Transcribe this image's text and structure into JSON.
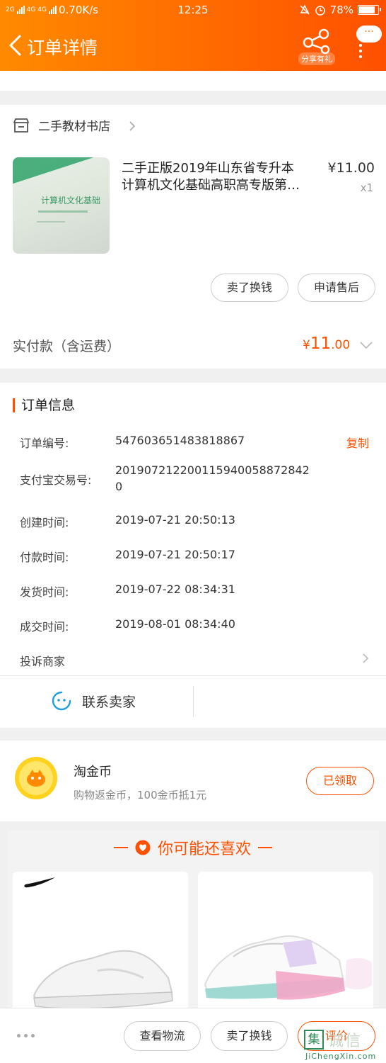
{
  "status_bar": {
    "network": "2G",
    "network2": "4G 4G",
    "speed": "0.70K/s",
    "time": "12:25",
    "battery": "78%",
    "battery_level": 0.78
  },
  "nav": {
    "title": "订单详情",
    "share_label": "分享有礼",
    "more_bubble": "···"
  },
  "shop": {
    "name": "二手教材书店"
  },
  "item": {
    "thumb_text": "计算机文化基础",
    "title_line1": "二手正版2019年山东省专升本",
    "title_line2": "计算机文化基础高职高专版第…",
    "price": "¥11.00",
    "quantity": "x1",
    "btn_resell": "卖了换钱",
    "btn_after_sale": "申请售后"
  },
  "paid": {
    "label": "实付款（含运费）",
    "yen": "¥",
    "integer": "11",
    "decimal": ".00"
  },
  "order_info": {
    "title": "订单信息",
    "copy": "复制",
    "rows": [
      {
        "label": "订单编号:",
        "value": "547603651483818867"
      },
      {
        "label": "支付宝交易号:",
        "value_line1": "20190721220011594005887284​2",
        "value_line2": "0"
      },
      {
        "label": "创建时间:",
        "value": "2019-07-21 20:50:13"
      },
      {
        "label": "付款时间:",
        "value": "2019-07-21 20:50:17"
      },
      {
        "label": "发货时间:",
        "value": "2019-07-22 08:34:31"
      },
      {
        "label": "成交时间:",
        "value": "2019-08-01 08:34:40"
      }
    ],
    "complain": "投诉商家",
    "contact": "联系卖家"
  },
  "coins": {
    "title": "淘金币",
    "subtitle": "购物返金币，100金币抵1元",
    "button": "已领取"
  },
  "recommend": {
    "title": "你可能还喜欢"
  },
  "bottom_bar": {
    "logistics": "查看物流",
    "resell": "卖了换钱",
    "review": "评价"
  },
  "watermark": {
    "box": "集",
    "text": "诚信",
    "url": "JiChengXin.com"
  },
  "colors": {
    "accent": "#ff5000",
    "header_start": "#ff8a00",
    "header_end": "#ff5000"
  }
}
